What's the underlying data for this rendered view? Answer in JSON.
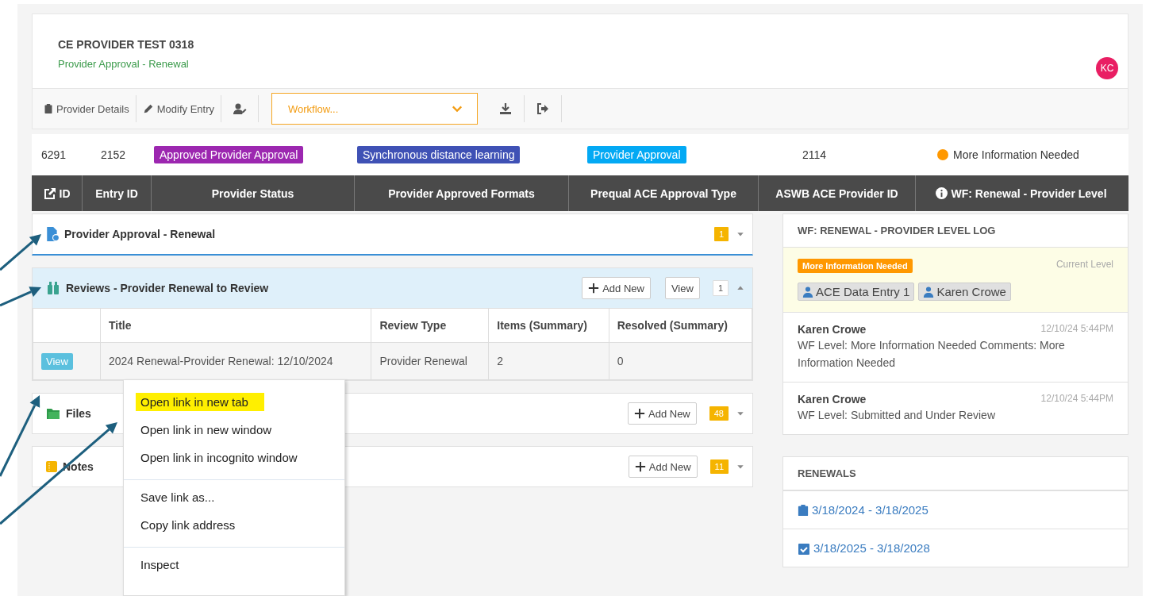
{
  "header": {
    "title": "CE PROVIDER TEST 0318",
    "subtitle": "Provider Approval - Renewal",
    "avatar": "KC"
  },
  "toolbar": {
    "buttons": [
      {
        "label": "Provider Details"
      },
      {
        "label": "Modify Entry"
      }
    ],
    "workflow_select": {
      "value": "Workflow..."
    }
  },
  "summary": [
    {
      "kind": "text",
      "text": "6291"
    },
    {
      "kind": "text",
      "text": "2152"
    },
    {
      "kind": "badge",
      "text": "Approved Provider Approval",
      "color": "#9c27b0"
    },
    {
      "kind": "badge",
      "text": "Synchronous distance learning",
      "color": "#3f51b5"
    },
    {
      "kind": "badge",
      "text": "Provider Approval",
      "color": "#03a9f4"
    },
    {
      "kind": "text",
      "text": "2114"
    },
    {
      "kind": "status",
      "text": "More Information Needed",
      "color": "#ff9800"
    }
  ],
  "columns": [
    "ID",
    "Entry ID",
    "Provider Status",
    "Provider Approved Formats",
    "Prequal ACE Approval Type",
    "ASWB ACE Provider ID",
    "WF: Renewal - Provider Level"
  ],
  "panels": [
    {
      "title": "Provider Approval - Renewal",
      "count": "1",
      "expanded": false,
      "active": true
    },
    {
      "title": "Reviews - Provider Renewal to Review",
      "count": "1",
      "expanded": true,
      "active": false,
      "add_label": "Add New",
      "view_label": "View",
      "table": {
        "columns": [
          "Title",
          "Review Type",
          "Items (Summary)",
          "Resolved (Summary)"
        ],
        "rows": [
          {
            "action": "View",
            "cells": [
              "2024 Renewal-Provider Renewal: 12/10/2024",
              "Provider Renewal",
              "2",
              "0"
            ]
          }
        ]
      }
    },
    {
      "title": "Files",
      "count": "48",
      "expanded": false,
      "active": false,
      "add_label": "Add New"
    },
    {
      "title": "Notes",
      "count": "11",
      "expanded": false,
      "active": false,
      "add_label": "Add New"
    }
  ],
  "log": {
    "title": "WF: RENEWAL - PROVIDER LEVEL LOG",
    "current": {
      "status": "More Information Needed",
      "label": "Current Level",
      "assignees": [
        "ACE Data Entry 1",
        "Karen Crowe"
      ]
    },
    "entries": [
      {
        "author": "Karen Crowe",
        "time": "12/10/24 5:44PM",
        "text": "WF Level: More Information Needed Comments: More Information Needed"
      },
      {
        "author": "Karen Crowe",
        "time": "12/10/24 5:44PM",
        "text": "WF Level: Submitted and Under Review"
      }
    ]
  },
  "renewals": {
    "title": "RENEWALS",
    "items": [
      {
        "label": "3/18/2024 - 3/18/2025"
      },
      {
        "label": "3/18/2025 - 3/18/2028"
      }
    ]
  },
  "context_menu": {
    "groups": [
      [
        {
          "label": "Open link in new tab",
          "highlighted": true
        },
        {
          "label": "Open link in new window",
          "highlighted": false
        },
        {
          "label": "Open link in incognito window",
          "highlighted": false
        }
      ],
      [
        {
          "label": "Save link as...",
          "highlighted": false
        },
        {
          "label": "Copy link address",
          "highlighted": false
        }
      ],
      [
        {
          "label": "Inspect",
          "highlighted": false
        }
      ]
    ]
  }
}
